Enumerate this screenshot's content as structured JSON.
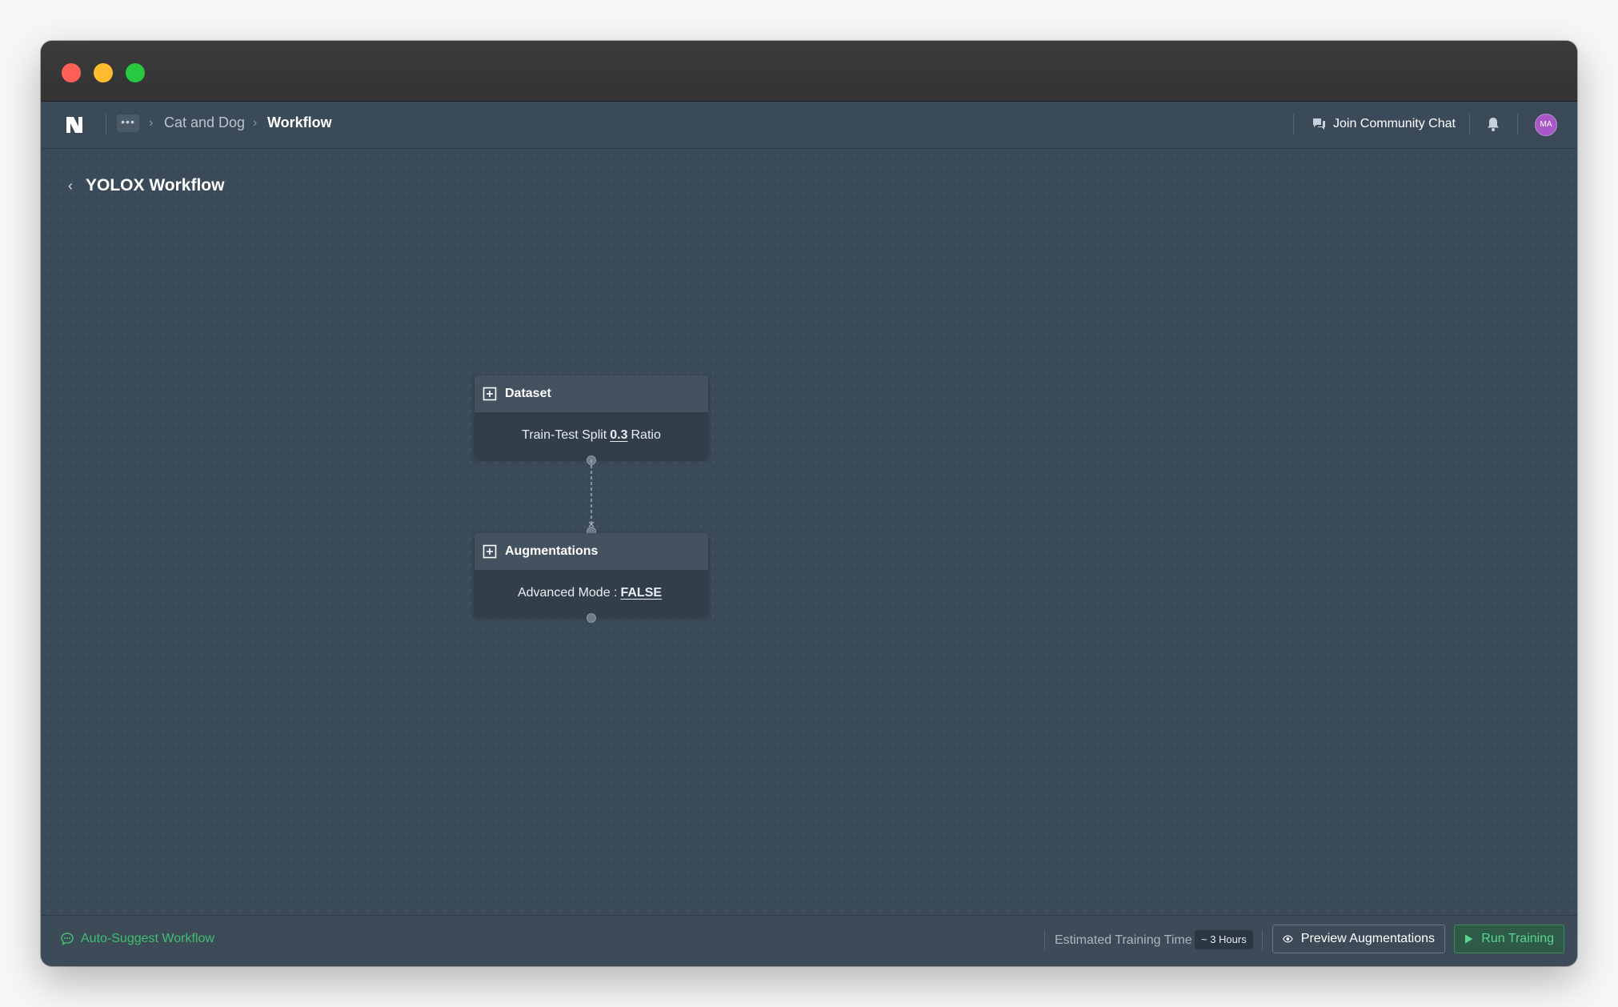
{
  "navbar": {
    "logo_icon": "n-logo-icon",
    "more_label": "•••",
    "breadcrumb": [
      "Cat and Dog",
      "Workflow"
    ],
    "community_label": "Join Community Chat",
    "avatar_initials": "MA"
  },
  "page": {
    "title": "YOLOX Workflow"
  },
  "nodes": [
    {
      "title": "Dataset",
      "body_prefix": "Train-Test Split",
      "body_value": "0.3",
      "body_suffix": "Ratio"
    },
    {
      "title": "Augmentations",
      "body_prefix": "Advanced Mode :",
      "body_value": "FALSE",
      "body_suffix": ""
    }
  ],
  "footer": {
    "auto_suggest_label": "Auto-Suggest Workflow",
    "estimate_label": "Estimated Training Time",
    "estimate_value": "~ 3 Hours",
    "preview_label": "Preview Augmentations",
    "run_label": "Run Training"
  },
  "colors": {
    "canvas_bg": "#3b4a58",
    "accent_green": "#3fbf6f",
    "avatar_purple": "#a857c7"
  }
}
